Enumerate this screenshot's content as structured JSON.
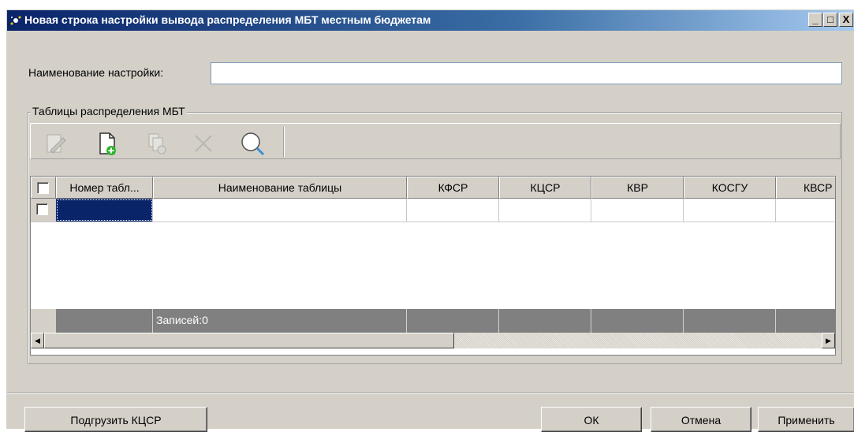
{
  "window": {
    "title": "Новая строка настройки вывода распределения МБТ местным бюджетам",
    "controls": {
      "minimize": "_",
      "maximize": "□",
      "close": "X"
    }
  },
  "form": {
    "name_label": "Наименование настройки:",
    "name_value": "",
    "group_title": "Таблицы распределения МБТ"
  },
  "toolbar": {
    "icons": [
      "edit-icon",
      "new-document-icon",
      "copy-icon",
      "delete-icon",
      "search-icon"
    ]
  },
  "grid": {
    "columns": [
      "",
      "Номер табл...",
      "Наименование таблицы",
      "КФСР",
      "КЦСР",
      "КВР",
      "КОСГУ",
      "КВСР"
    ],
    "footer": {
      "records": "Записей:0"
    }
  },
  "buttons": {
    "load": "Подгрузить КЦСР",
    "ok": "ОК",
    "cancel": "Отмена",
    "apply": "Применить"
  },
  "colors": {
    "window_bg": "#d4d0c8",
    "title_start": "#0a246a",
    "title_end": "#a6caf0",
    "selection": "#0a246a",
    "footer_bg": "#808080"
  }
}
